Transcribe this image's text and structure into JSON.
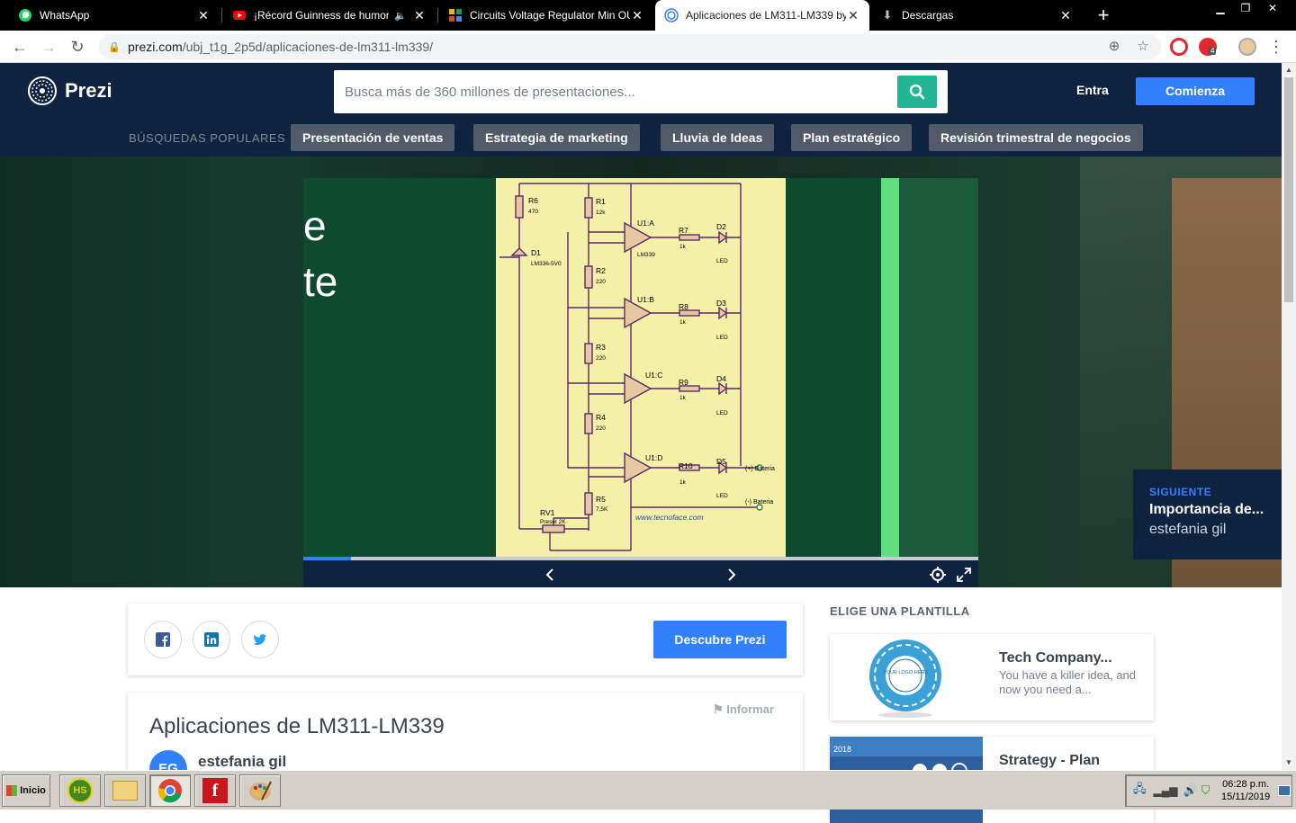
{
  "browser": {
    "tabs": [
      {
        "label": "WhatsApp",
        "icon": "whatsapp-icon",
        "active": false
      },
      {
        "label": "¡Récord Guinness de humor! Un",
        "icon": "youtube-icon",
        "active": false
      },
      {
        "label": "Circuits Voltage Regulator Min OUT",
        "icon": "circuits-icon",
        "active": false
      },
      {
        "label": "Aplicaciones de LM311-LM339 by es",
        "icon": "prezi-tab-icon",
        "active": true
      },
      {
        "label": "Descargas",
        "icon": "download-icon",
        "active": false
      }
    ],
    "url_domain": "prezi.com",
    "url_path": "/ubj_t1g_2p5d/aplicaciones-de-lm311-lm339/",
    "extension_badge": "4"
  },
  "header": {
    "brand": "Prezi",
    "search_placeholder": "Busca más de 360 millones de presentaciones...",
    "login_label": "Entra",
    "cta_label": "Comienza",
    "popular_label": "BÚSQUEDAS POPULARES",
    "popular_chips": [
      "Presentación de ventas",
      "Estrategia de marketing",
      "Lluvia de Ideas",
      "Plan estratégico",
      "Revisión trimestral de negocios"
    ]
  },
  "viewer": {
    "slide_text_line1": "e",
    "slide_text_line2": "te",
    "progress": 0.07,
    "schematic": {
      "watermark": "www.tecnoface.com",
      "labels": {
        "r6": "R6",
        "r6v": "470",
        "r1": "R1",
        "r1v": "12k",
        "d1": "D1",
        "d1v": "LM336-5V0",
        "r2": "R2",
        "r2v": "220",
        "r3": "R3",
        "r3v": "220",
        "r4": "R4",
        "r4v": "220",
        "r5": "R5",
        "r5v": "7,5K",
        "rv1": "RV1",
        "rv1v": "Preset 2K",
        "u1a": "U1:A",
        "u1av": "LM339",
        "u1b": "U1:B",
        "u1c": "U1:C",
        "u1d": "U1:D",
        "r7": "R7",
        "r8": "R8",
        "r9": "R9",
        "r10": "R10",
        "rk": "1k",
        "d2": "D2",
        "d3": "D3",
        "d4": "D4",
        "d5": "D5",
        "led": "LED",
        "bat_pos": "(+) Bateria",
        "bat_neg": "(-) Bateria"
      }
    },
    "next": {
      "label": "SIGUIENTE",
      "title": "Importancia de...",
      "author": "estefania gil"
    }
  },
  "share": {
    "discover_label": "Descubre Prezi"
  },
  "presentation": {
    "report_label": "Informar",
    "title": "Aplicaciones de LM311-LM339",
    "author_initials": "EG",
    "author": "estefania gil"
  },
  "templates": {
    "heading": "ELIGE UNA PLANTILLA",
    "items": [
      {
        "title": "Tech Company...",
        "description": "You have a killer idea, and now you need a...",
        "thumb_text": "YOUR LOGO HERE"
      },
      {
        "title": "Strategy - Plan",
        "description": "",
        "thumb_text": "2018"
      }
    ]
  },
  "taskbar": {
    "start_label": "Inicio",
    "hs_label": "HS",
    "time": "06:28 p.m.",
    "date": "15/11/2019"
  },
  "colors": {
    "prezi_navy": "#0e2340",
    "prezi_blue": "#3181ff",
    "search_green": "#21b691",
    "slide_green": "#0e4a2f",
    "schematic_bg": "#f5f0a8"
  }
}
